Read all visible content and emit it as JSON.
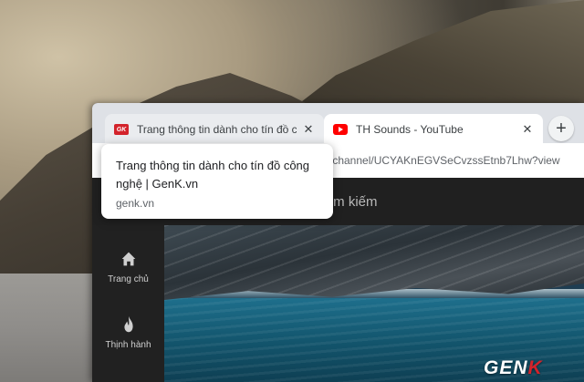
{
  "browser": {
    "tabs": [
      {
        "title": "Trang thông tin dành cho tín đồ c",
        "favicon": "genk-favicon",
        "active": true
      },
      {
        "title": "TH Sounds - YouTube",
        "favicon": "youtube-favicon",
        "active": false
      }
    ],
    "tab_close_glyph": "✕",
    "new_tab_glyph": "+",
    "address": "/channel/UCYAKnEGVSeCvzssEtnb7Lhw?view"
  },
  "hovercard": {
    "title": "Trang thông tin dành cho tín đồ công nghệ | GenK.vn",
    "domain": "genk.vn"
  },
  "youtube": {
    "search_placeholder": "ìm kiếm",
    "sidebar": [
      {
        "label": "Trang chủ",
        "icon": "home-icon"
      },
      {
        "label": "Thịnh hành",
        "icon": "flame-icon"
      }
    ]
  },
  "genk_favicon_text": "GK",
  "watermark": {
    "main": "GEN",
    "accent": "K"
  },
  "colors": {
    "tabstrip": "#dee1e6",
    "youtube_dark": "#181818",
    "genk_red": "#d3232b"
  }
}
